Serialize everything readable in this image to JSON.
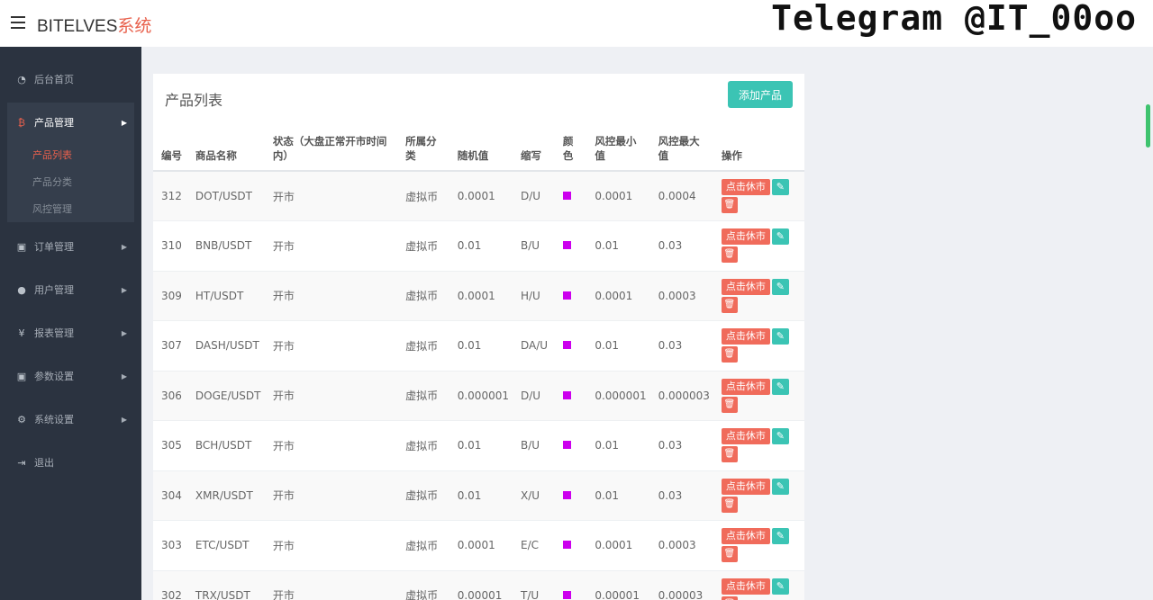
{
  "header": {
    "brand_main": "BITELVES",
    "brand_accent": "系统",
    "watermark": "Telegram @IT_00oo"
  },
  "sidebar": {
    "items": [
      {
        "label": "后台首页",
        "icon": "dashboard-icon",
        "glyph": "◔"
      },
      {
        "label": "产品管理",
        "icon": "bitcoin-icon",
        "glyph": "₿"
      },
      {
        "label": "订单管理",
        "icon": "copy-icon",
        "glyph": "▣"
      },
      {
        "label": "用户管理",
        "icon": "user-icon",
        "glyph": "👤"
      },
      {
        "label": "报表管理",
        "icon": "yen-icon",
        "glyph": "¥"
      },
      {
        "label": "参数设置",
        "icon": "copy-icon",
        "glyph": "▣"
      },
      {
        "label": "系统设置",
        "icon": "gears-icon",
        "glyph": "⚙"
      },
      {
        "label": "退出",
        "icon": "sign-out-icon",
        "glyph": "⇥"
      }
    ],
    "sub_items": [
      "产品列表",
      "产品分类",
      "风控管理"
    ]
  },
  "main": {
    "title": "产品列表",
    "add_button": "添加产品",
    "columns": [
      "编号",
      "商品名称",
      "状态（大盘正常开市时间内）",
      "所属分类",
      "随机值",
      "缩写",
      "颜色",
      "风控最小值",
      "风控最大值",
      "操作"
    ],
    "rows": [
      {
        "id": "312",
        "name": "DOT/USDT",
        "status": "开市",
        "category": "虚拟币",
        "random": "0.0001",
        "abbr": "D/U",
        "min": "0.0001",
        "max": "0.0004"
      },
      {
        "id": "310",
        "name": "BNB/USDT",
        "status": "开市",
        "category": "虚拟币",
        "random": "0.01",
        "abbr": "B/U",
        "min": "0.01",
        "max": "0.03"
      },
      {
        "id": "309",
        "name": "HT/USDT",
        "status": "开市",
        "category": "虚拟币",
        "random": "0.0001",
        "abbr": "H/U",
        "min": "0.0001",
        "max": "0.0003"
      },
      {
        "id": "307",
        "name": "DASH/USDT",
        "status": "开市",
        "category": "虚拟币",
        "random": "0.01",
        "abbr": "DA/U",
        "min": "0.01",
        "max": "0.03"
      },
      {
        "id": "306",
        "name": "DOGE/USDT",
        "status": "开市",
        "category": "虚拟币",
        "random": "0.000001",
        "abbr": "D/U",
        "min": "0.000001",
        "max": "0.000003"
      },
      {
        "id": "305",
        "name": "BCH/USDT",
        "status": "开市",
        "category": "虚拟币",
        "random": "0.01",
        "abbr": "B/U",
        "min": "0.01",
        "max": "0.03"
      },
      {
        "id": "304",
        "name": "XMR/USDT",
        "status": "开市",
        "category": "虚拟币",
        "random": "0.01",
        "abbr": "X/U",
        "min": "0.01",
        "max": "0.03"
      },
      {
        "id": "303",
        "name": "ETC/USDT",
        "status": "开市",
        "category": "虚拟币",
        "random": "0.0001",
        "abbr": "E/C",
        "min": "0.0001",
        "max": "0.0003"
      },
      {
        "id": "302",
        "name": "TRX/USDT",
        "status": "开市",
        "category": "虚拟币",
        "random": "0.00001",
        "abbr": "T/U",
        "min": "0.00001",
        "max": "0.00003"
      }
    ],
    "swatch_color": "#cc00ee",
    "close_button": "点击休市",
    "edit_icon": "pencil-icon",
    "delete_icon": "trash-icon"
  },
  "colors": {
    "accent": "#e8604c",
    "teal": "#3bc4b4",
    "sidebar_bg": "#2b3340"
  }
}
